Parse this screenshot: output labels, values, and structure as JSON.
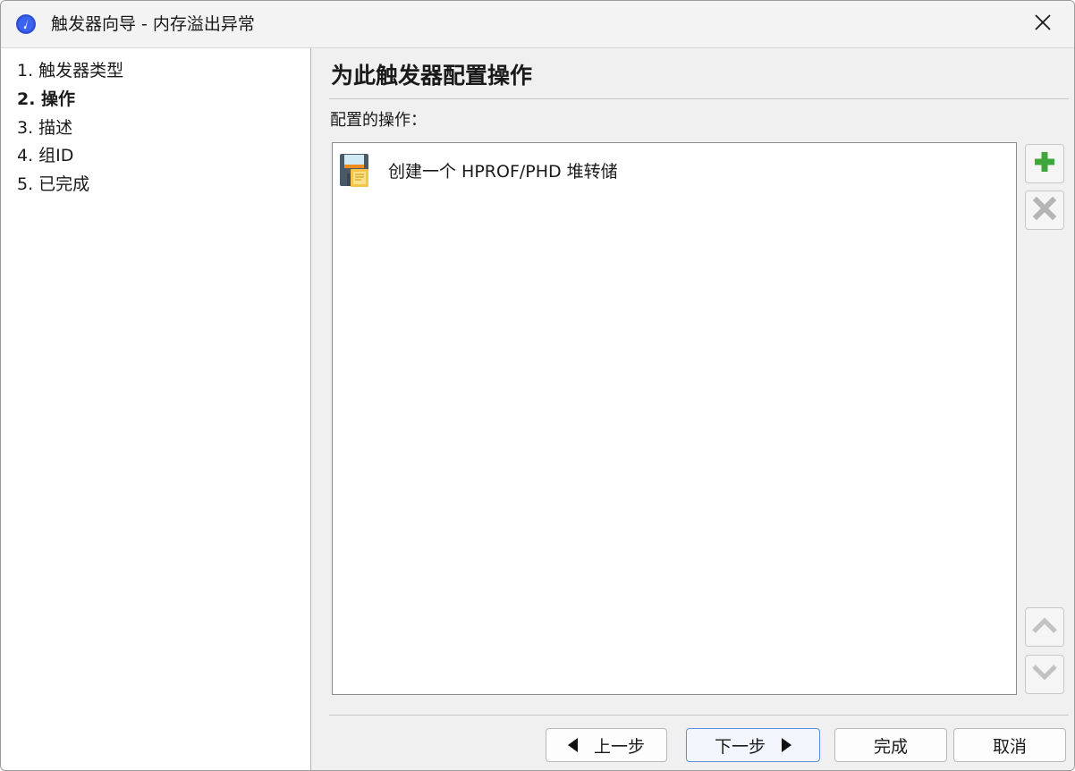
{
  "window": {
    "title": "触发器向导 - 内存溢出异常",
    "app_icon": "compass-app-icon",
    "close_icon": "close-icon"
  },
  "sidebar": {
    "steps": [
      {
        "label": "1. 触发器类型",
        "active": false
      },
      {
        "label": "2. 操作",
        "active": true
      },
      {
        "label": "3. 描述",
        "active": false
      },
      {
        "label": "4. 组ID",
        "active": false
      },
      {
        "label": "5. 已完成",
        "active": false
      }
    ]
  },
  "main": {
    "title": "为此触发器配置操作",
    "list_label": "配置的操作：",
    "actions": [
      {
        "label": "创建一个 HPROF/PHD 堆转储",
        "icon": "heap-dump-icon"
      }
    ],
    "side_buttons": {
      "add": "plus-icon",
      "remove": "delete-icon",
      "move_up": "chevron-up-icon",
      "move_down": "chevron-down-icon"
    }
  },
  "footer": {
    "back_label": "上一步",
    "next_label": "下一步",
    "finish_label": "完成",
    "cancel_label": "取消"
  },
  "colors": {
    "add_icon": "#3ea63a",
    "disabled_icon": "#b5b5b5",
    "focus_border": "#5b8fd9"
  }
}
